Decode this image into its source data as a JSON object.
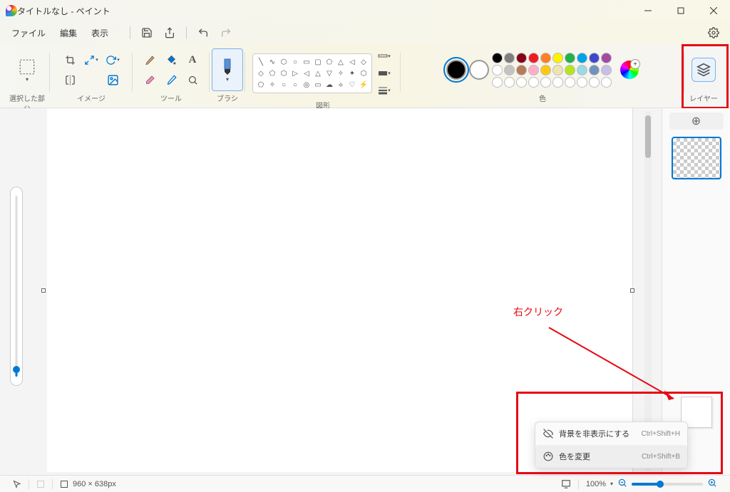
{
  "title": "タイトルなし - ペイント",
  "menu": {
    "file": "ファイル",
    "edit": "編集",
    "view": "表示"
  },
  "groups": {
    "selection": "選択した部分",
    "image": "イメージ",
    "tools": "ツール",
    "brush": "ブラシ",
    "shapes": "図形",
    "color": "色",
    "layers": "レイヤー"
  },
  "context_menu": {
    "hide_bg": {
      "label": "背景を非表示にする",
      "shortcut": "Ctrl+Shift+H"
    },
    "change_color": {
      "label": "色を変更",
      "shortcut": "Ctrl+Shift+B"
    }
  },
  "annotation": {
    "right_click": "右クリック"
  },
  "status": {
    "canvas_size": "960 × 638px",
    "zoom_percent": "100%"
  },
  "palette_row1": [
    "#000000",
    "#7f7f7f",
    "#880015",
    "#ed1c24",
    "#ff7f27",
    "#fff200",
    "#22b14c",
    "#00a2e8",
    "#3f48cc",
    "#a349a4"
  ],
  "palette_row2": [
    "#ffffff",
    "#c3c3c3",
    "#b97a57",
    "#ffaec9",
    "#ffc90e",
    "#efe4b0",
    "#b5e61d",
    "#99d9ea",
    "#7092be",
    "#c8bfe7"
  ],
  "palette_row3": [
    "#ffffff",
    "#ffffff",
    "#ffffff",
    "#ffffff",
    "#ffffff",
    "#ffffff",
    "#ffffff",
    "#ffffff",
    "#ffffff",
    "#ffffff"
  ]
}
